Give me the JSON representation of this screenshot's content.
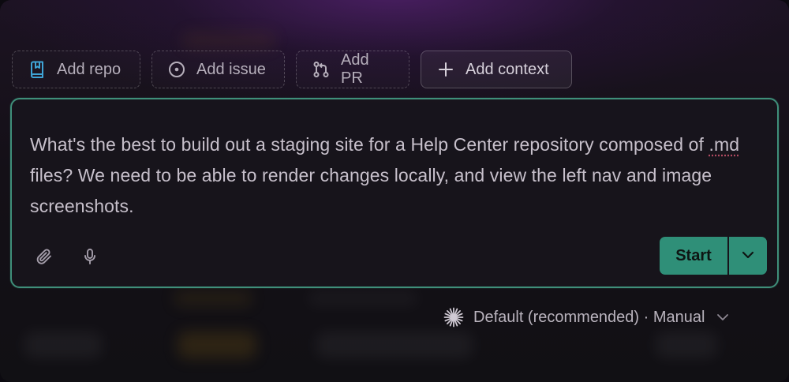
{
  "chips": {
    "add_repo": "Add repo",
    "add_issue": "Add issue",
    "add_pr": "Add PR",
    "add_context": "Add context"
  },
  "prompt": {
    "text_before": "What's the best to build out a staging site for a Help Center repository composed of ",
    "text_flagged": ".md",
    "text_after": " files? We need to be able to render changes locally, and view the left nav and image screenshots."
  },
  "actions": {
    "start_label": "Start"
  },
  "model_selector": {
    "label": "Default (recommended) · Manual"
  },
  "icons": {
    "repo": "book-icon",
    "issue": "circle-dot-icon",
    "pr": "pull-request-icon",
    "context": "plus-icon",
    "attach": "paperclip-icon",
    "mic": "microphone-icon",
    "dropdown": "chevron-down-icon",
    "model": "sparkle-icon"
  },
  "colors": {
    "accent": "#2f8f78",
    "border_focus": "#3f8f7a",
    "repo_icon": "#3fa4d6"
  }
}
